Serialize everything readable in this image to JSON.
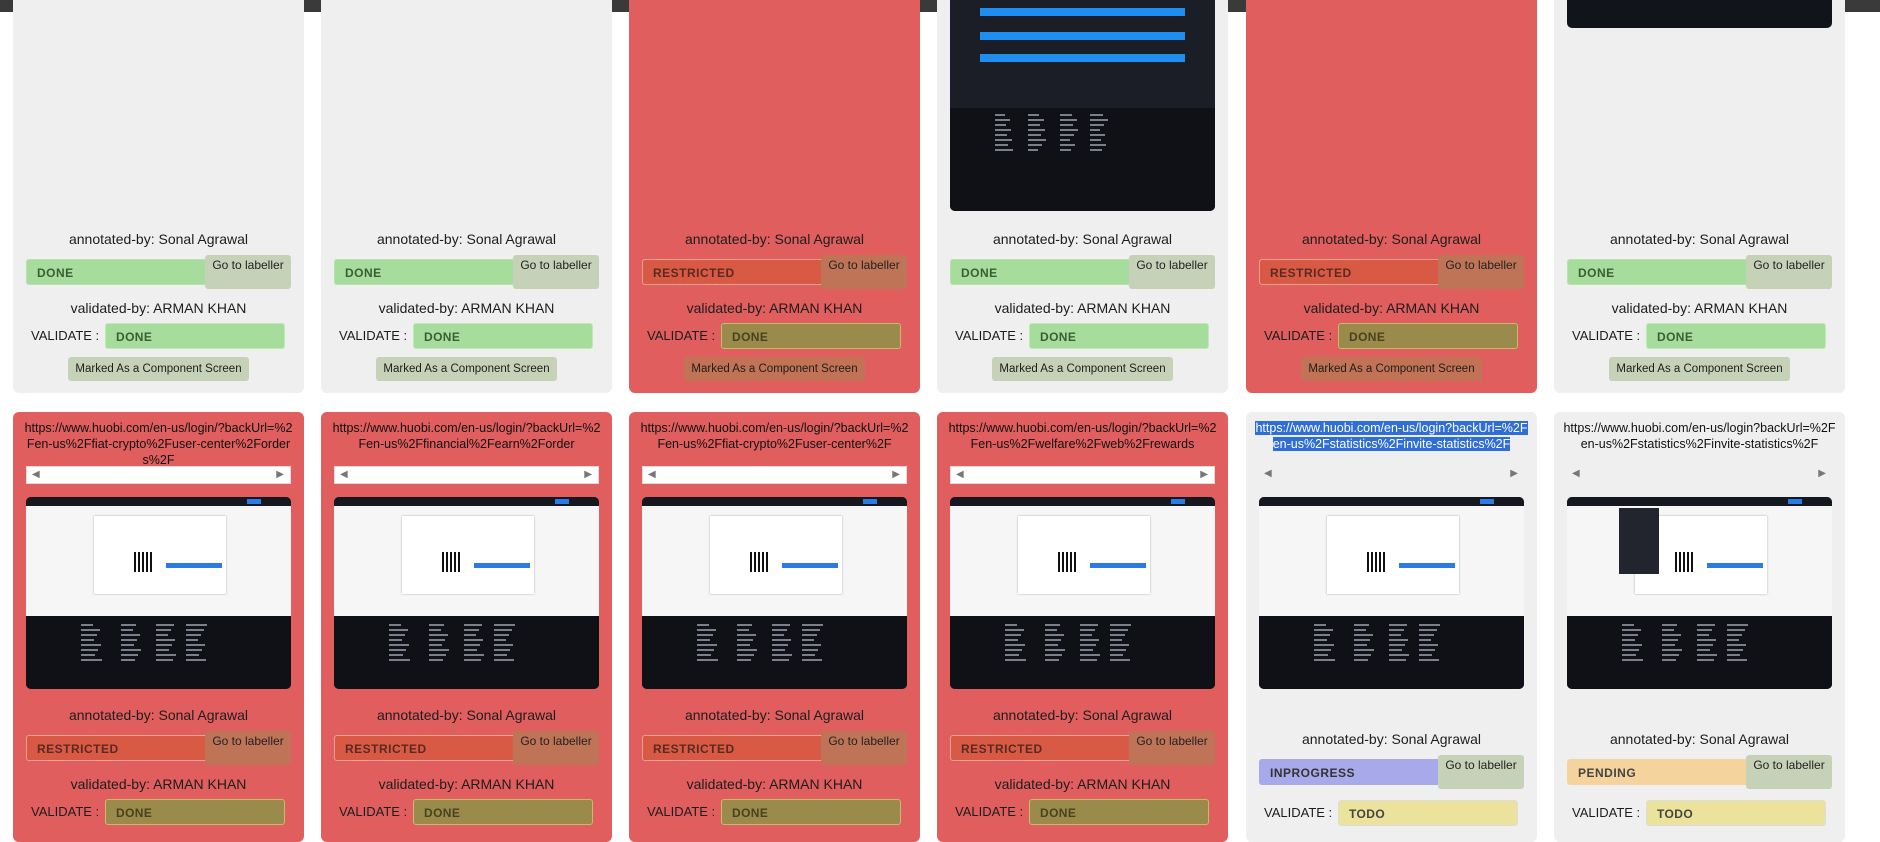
{
  "labels": {
    "annotated_prefix": "annotated-by:",
    "validated_prefix": "validated-by:",
    "annotator": "Sonal Agrawal",
    "validator": "ARMAN KHAN",
    "go_to_labeller": "Go to labeller",
    "validate": "VALIDATE :",
    "component_screen": "Marked As a Component Screen",
    "arrow_left": "◀",
    "arrow_right": "▶"
  },
  "row1": [
    {
      "theme": "gray",
      "status": "DONE",
      "validate": "DONE"
    },
    {
      "theme": "gray",
      "status": "DONE",
      "validate": "DONE"
    },
    {
      "theme": "red",
      "status": "RESTRICTED",
      "validate": "DONE"
    },
    {
      "theme": "gray",
      "status": "DONE",
      "validate": "DONE"
    },
    {
      "theme": "red",
      "status": "RESTRICTED",
      "validate": "DONE"
    },
    {
      "theme": "gray",
      "status": "DONE",
      "validate": "DONE"
    }
  ],
  "row2": [
    {
      "theme": "red",
      "url": "https://www.huobi.com/en-us/login/?backUrl=%2Fen-us%2Ffiat-crypto%2Fuser-center%2Forders%2F",
      "status": "RESTRICTED",
      "validate": "DONE"
    },
    {
      "theme": "red",
      "url": "https://www.huobi.com/en-us/login/?backUrl=%2Fen-us%2Ffinancial%2Fearn%2Forder",
      "status": "RESTRICTED",
      "validate": "DONE"
    },
    {
      "theme": "red",
      "url": "https://www.huobi.com/en-us/login/?backUrl=%2Fen-us%2Ffiat-crypto%2Fuser-center%2F",
      "status": "RESTRICTED",
      "validate": "DONE"
    },
    {
      "theme": "red",
      "url": "https://www.huobi.com/en-us/login/?backUrl=%2Fen-us%2Fwelfare%2Fweb%2Frewards",
      "status": "RESTRICTED",
      "validate": "DONE"
    },
    {
      "theme": "gray",
      "url": "https://www.huobi.com/en-us/login?backUrl=%2Fen-us%2Fstatistics%2Finvite-statistics%2F",
      "status": "INPROGRESS",
      "validate": "TODO",
      "selected": true
    },
    {
      "theme": "gray",
      "url": "https://www.huobi.com/en-us/login?backUrl=%2Fen-us%2Fstatistics%2Finvite-statistics%2F",
      "status": "PENDING",
      "validate": "TODO"
    }
  ]
}
